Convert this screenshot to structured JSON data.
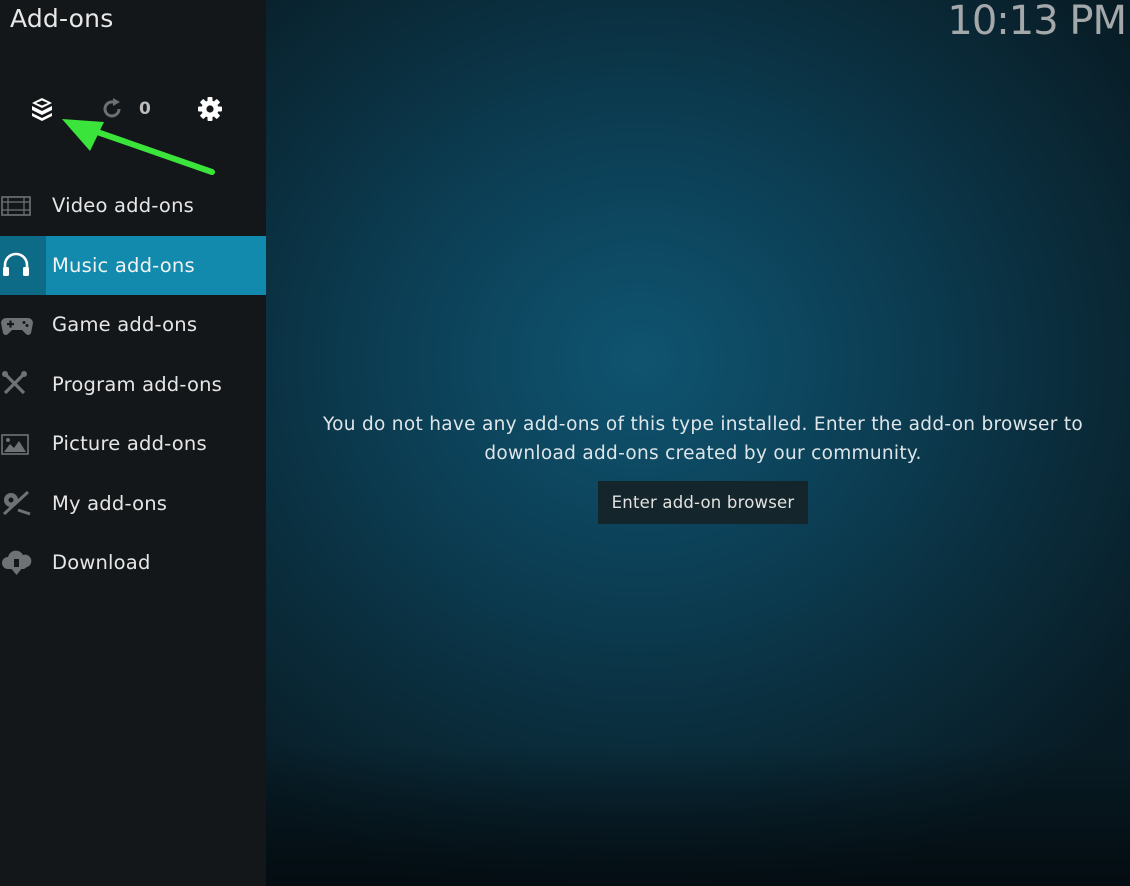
{
  "window": {
    "title": "Add-ons",
    "clock": "10:13 PM"
  },
  "toolbar": {
    "items": [
      {
        "icon": "addon-box-icon"
      },
      {
        "icon": "refresh-icon",
        "count": "0"
      },
      {
        "icon": "gear-icon"
      }
    ]
  },
  "annotation": {
    "arrow_color": "#3be43b"
  },
  "sidebar": {
    "items": [
      {
        "label": "Video add-ons",
        "icon": "film-icon",
        "active": false
      },
      {
        "label": "Music add-ons",
        "icon": "headphones-icon",
        "active": true
      },
      {
        "label": "Game add-ons",
        "icon": "gamepad-icon",
        "active": false
      },
      {
        "label": "Program add-ons",
        "icon": "tools-icon",
        "active": false
      },
      {
        "label": "Picture add-ons",
        "icon": "picture-icon",
        "active": false
      },
      {
        "label": "My add-ons",
        "icon": "my-addons-icon",
        "active": false
      },
      {
        "label": "Download",
        "icon": "cloud-download-icon",
        "active": false
      }
    ]
  },
  "main": {
    "message_line1": "You do not have any add-ons of this type installed. Enter the add-on browser to",
    "message_line2": "download add-ons created by our community.",
    "button_label": "Enter add-on browser"
  },
  "colors": {
    "accent": "#128aad",
    "sidebar_bg": "#131719",
    "background": "#0c4158"
  }
}
